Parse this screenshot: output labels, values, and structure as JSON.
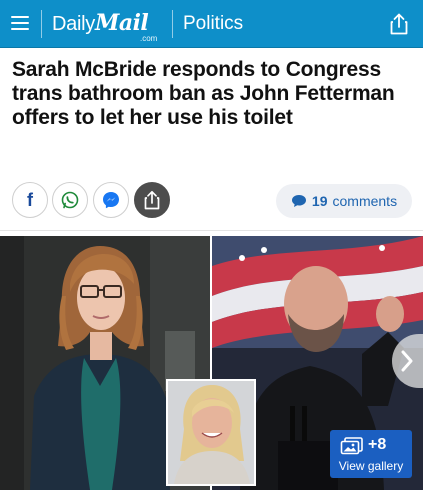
{
  "header": {
    "logo_daily": "Daily",
    "logo_mail": "Mail",
    "logo_com": ".com",
    "section": "Politics",
    "bg_color": "#0e8fc9"
  },
  "article": {
    "headline": "Sarah McBride responds to Congress trans bathroom ban as John Fetterman offers to let her use his toilet"
  },
  "social": {
    "buttons": [
      {
        "name": "facebook",
        "icon": "facebook-icon",
        "glyph": "f"
      },
      {
        "name": "whatsapp",
        "icon": "whatsapp-icon"
      },
      {
        "name": "messenger",
        "icon": "messenger-icon"
      },
      {
        "name": "share",
        "icon": "share-icon"
      }
    ],
    "comments_count": "19",
    "comments_label": "comments"
  },
  "gallery": {
    "count": "+8",
    "label": "View gallery"
  }
}
